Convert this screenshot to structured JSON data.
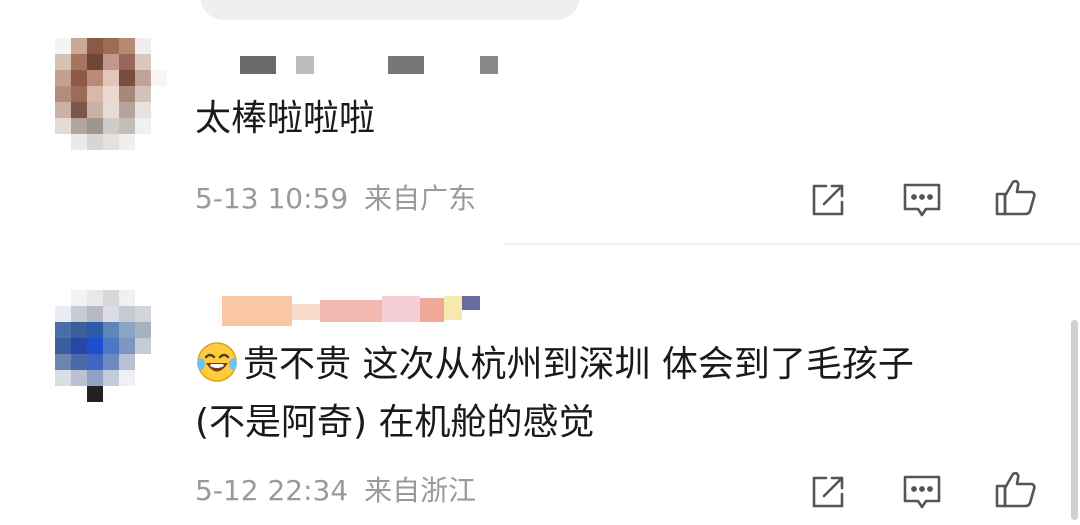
{
  "comments": [
    {
      "text": "太棒啦啦啦",
      "time": "5-13 10:59",
      "location": "来自广东"
    },
    {
      "emoji": "laughing-tears-emoji",
      "text_line1": "贵不贵 这次从杭州到深圳 体会到了毛孩子",
      "text_line2": "(不是阿奇) 在机舱的感觉",
      "time": "5-12 22:34",
      "location": "来自浙江"
    }
  ],
  "icons": {
    "share": "share-icon",
    "reply": "reply-icon",
    "like": "like-icon"
  },
  "colors": {
    "text": "#1a1a1a",
    "meta": "#9a9a9a",
    "icon": "#555555",
    "divider": "#eeeeee"
  }
}
